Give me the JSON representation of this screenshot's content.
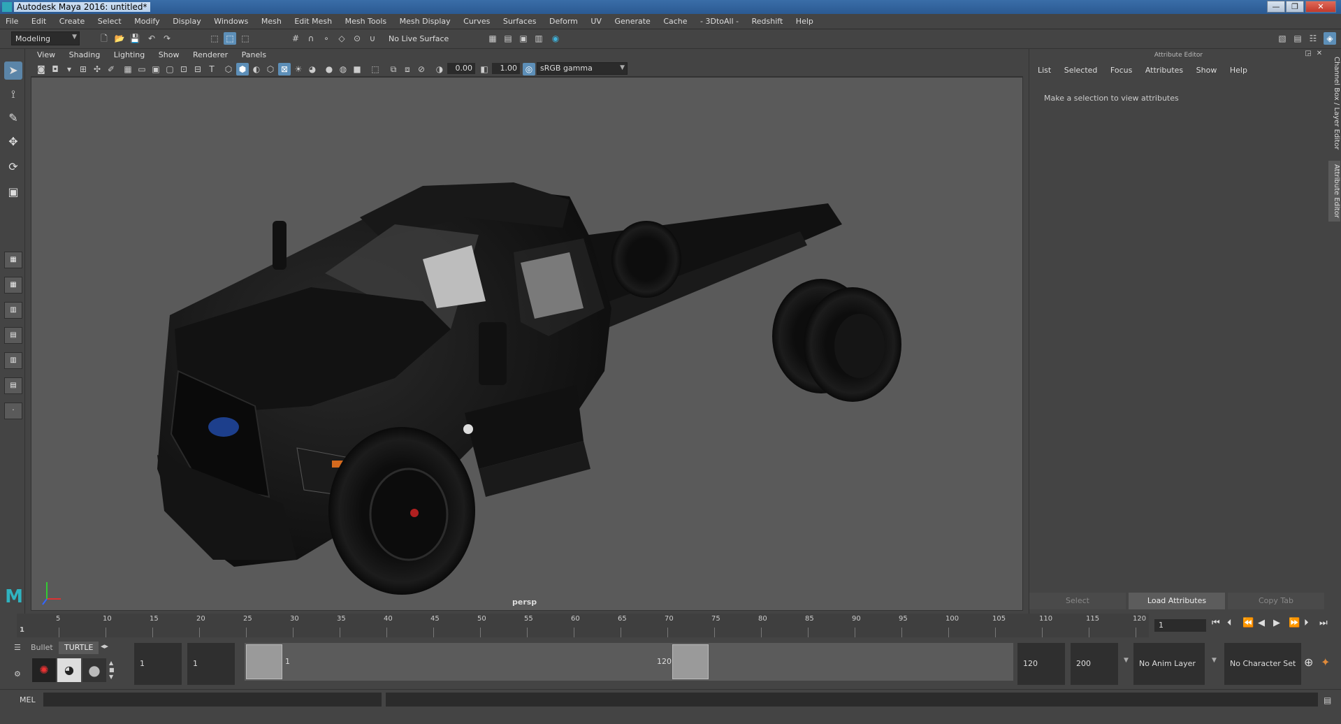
{
  "window": {
    "title": "Autodesk Maya 2016: untitled*",
    "controls": [
      "—",
      "❐",
      "✕"
    ]
  },
  "menubar": [
    "File",
    "Edit",
    "Create",
    "Select",
    "Modify",
    "Display",
    "Windows",
    "Mesh",
    "Edit Mesh",
    "Mesh Tools",
    "Mesh Display",
    "Curves",
    "Surfaces",
    "Deform",
    "UV",
    "Generate",
    "Cache",
    "- 3DtoAll -",
    "Redshift",
    "Help"
  ],
  "statusline": {
    "menuset": "Modeling",
    "live_surface": "No Live Surface"
  },
  "panel": {
    "menu": [
      "View",
      "Shading",
      "Lighting",
      "Show",
      "Renderer",
      "Panels"
    ],
    "exposure": "0.00",
    "gamma": "1.00",
    "color_space": "sRGB gamma",
    "camera_label": "persp"
  },
  "attribute_editor": {
    "title": "Attribute Editor",
    "menu": [
      "List",
      "Selected",
      "Focus",
      "Attributes",
      "Show",
      "Help"
    ],
    "message": "Make a selection to view attributes",
    "buttons": {
      "select": "Select",
      "load": "Load Attributes",
      "copy": "Copy Tab"
    }
  },
  "side_tabs": {
    "channel_box": "Channel Box / Layer Editor",
    "attribute_editor": "Attribute Editor"
  },
  "timeline": {
    "ticks": [
      "5",
      "10",
      "15",
      "20",
      "25",
      "30",
      "35",
      "40",
      "45",
      "50",
      "55",
      "60",
      "65",
      "70",
      "75",
      "80",
      "85",
      "90",
      "95",
      "100",
      "105",
      "110",
      "115",
      "120"
    ],
    "start_label": "1",
    "current_frame": "1"
  },
  "range": {
    "start": "1",
    "playback_start": "1",
    "range_start_label": "1",
    "range_end_label": "120",
    "playback_end": "120",
    "end": "200",
    "anim_layer": "No Anim Layer",
    "character_set": "No Character Set"
  },
  "shelf_tabs": {
    "bullet": "Bullet",
    "turtle": "TURTLE"
  },
  "cmdline": {
    "mode": "MEL"
  }
}
